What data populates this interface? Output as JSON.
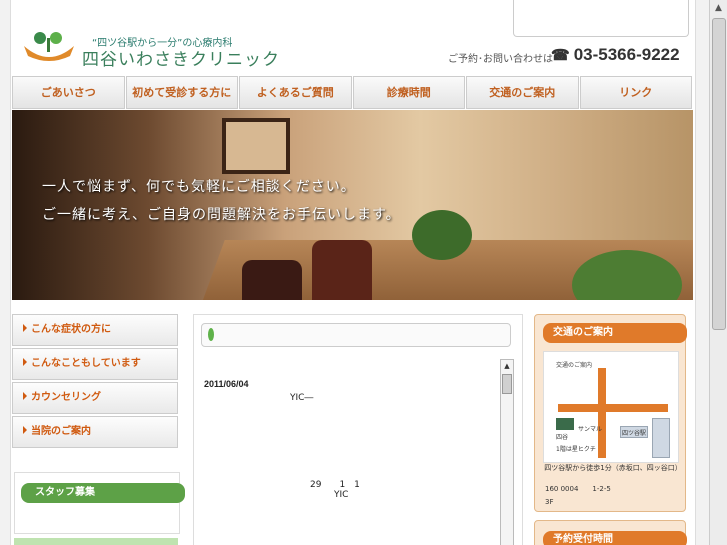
{
  "header": {
    "tagline": "“四ツ谷駅から一分”の心療内科",
    "clinic_name": "四谷いわさきクリニック",
    "contact_label": "ご予約･お問い合わせは",
    "phone": "03-5366-9222"
  },
  "nav": {
    "items": [
      "ごあいさつ",
      "初めて受診する方に",
      "よくあるご質問",
      "診療時間",
      "交通のご案内",
      "リンク"
    ]
  },
  "hero": {
    "line1": "一人で悩まず、何でも気軽にご相談ください。",
    "line2": "ご一緒に考え、ご自身の問題解決をお手伝いします。"
  },
  "sidebar_left": {
    "items": [
      "こんな症状の方に",
      "こんなこともしています",
      "カウンセリング",
      "当院のご案内"
    ],
    "staff_banner": "スタッフ募集"
  },
  "main": {
    "post_date": "2011/06/04",
    "post_title": "YIC―",
    "post_body": "29　　1　1",
    "post_sign": "YIC"
  },
  "sidebar_right": {
    "access_title": "交通のご案内",
    "map": {
      "title": "交通のご案内",
      "labels": {
        "yotsuya": "四谷",
        "sanmaru": "サンマル",
        "first_floor": "1階は星ヒクチ",
        "station": "四ツ谷駅"
      }
    },
    "access_note": "四ツ谷駅から徒歩1分（赤坂口、四ッ谷口）",
    "address_line1": "160 0004　　1-2-5",
    "address_line2": "3F",
    "hours_title": "予約受付時間"
  },
  "colors": {
    "nav_text": "#c06020",
    "accent": "#e07a2a",
    "green": "#5da147"
  },
  "icons": [
    "clinic-logo-icon",
    "telephone-icon",
    "leaf-icon",
    "scroll-up-icon"
  ]
}
